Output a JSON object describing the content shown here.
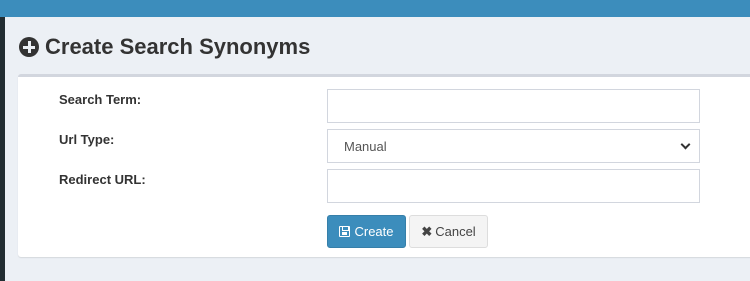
{
  "header": {
    "title": "Create Search Synonyms",
    "icon": "plus-circle-icon"
  },
  "form": {
    "search_term": {
      "label": "Search Term:",
      "value": ""
    },
    "url_type": {
      "label": "Url Type:",
      "selected": "Manual"
    },
    "redirect_url": {
      "label": "Redirect URL:",
      "value": ""
    }
  },
  "actions": {
    "create_label": "Create",
    "cancel_label": "Cancel",
    "create_icon": "floppy-disk-icon",
    "cancel_icon": "close-icon"
  },
  "colors": {
    "topbar": "#3c8dbc",
    "primary": "#3c8dbc",
    "background": "#ecf0f5"
  }
}
